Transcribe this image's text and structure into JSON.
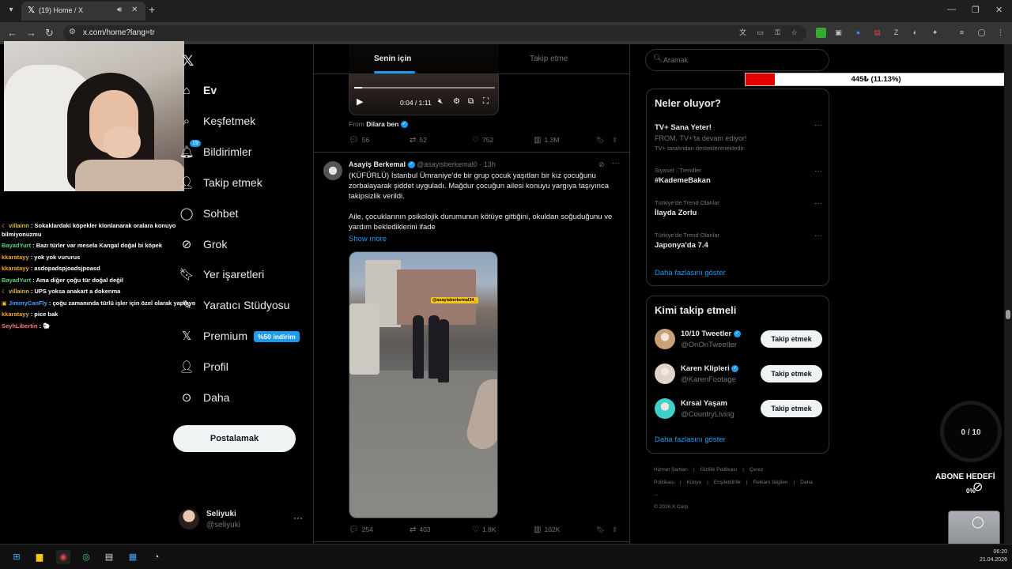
{
  "browser": {
    "tab_title": "(19) Home / X",
    "url": "x.com/home?lang=tr"
  },
  "chat": [
    {
      "user": "villainn",
      "color": "#d9b84a",
      "text": "Sokaklardaki köpekler klonlanarak oralara konuyo bilmiyonuzmu",
      "badge": "moon"
    },
    {
      "user": "BayadYurt",
      "color": "#5bd17a",
      "text": "Bazı türler var mesela Kangal doğal bi köpek",
      "badge": ""
    },
    {
      "user": "kkaratayy",
      "color": "#f0a830",
      "text": "yok yok vururus",
      "badge": ""
    },
    {
      "user": "kkaratayy",
      "color": "#f0a830",
      "text": "asdopadspjoadsjpoasd",
      "badge": ""
    },
    {
      "user": "BayadYurt",
      "color": "#5bd17a",
      "text": "Ama diğer çoğu tür doğal değil",
      "badge": ""
    },
    {
      "user": "villainn",
      "color": "#d9b84a",
      "text": "UPS yoksa anakart a dokenma",
      "badge": "moon"
    },
    {
      "user": "JimmyCanFly",
      "color": "#4a9cff",
      "text": "çoğu zamanında türlü işler için özel olarak yapılıyo",
      "badge": "sub"
    },
    {
      "user": "kkaratayy",
      "color": "#f0a830",
      "text": "pice bak",
      "badge": ""
    },
    {
      "user": "SeyhLibertin",
      "color": "#ff7a7a",
      "text": "🐑",
      "badge": ""
    }
  ],
  "nav": {
    "items": [
      {
        "label": "Ev",
        "icon": "home-icon"
      },
      {
        "label": "Keşfetmek",
        "icon": "search-icon"
      },
      {
        "label": "Bildirimler",
        "icon": "bell-icon"
      },
      {
        "label": "Takip etmek",
        "icon": "follow-icon"
      },
      {
        "label": "Sohbet",
        "icon": "chat-icon"
      },
      {
        "label": "Grok",
        "icon": "grok-icon"
      },
      {
        "label": "Yer işaretleri",
        "icon": "bookmark-icon"
      },
      {
        "label": "Yaratıcı Stüdyosu",
        "icon": "studio-icon"
      },
      {
        "label": "Premium",
        "icon": "x-icon"
      },
      {
        "label": "Profil",
        "icon": "person-icon"
      },
      {
        "label": "Daha",
        "icon": "more-icon"
      }
    ],
    "notif_count": "19",
    "premium_badge": "%50 indirim",
    "post_label": "Postalamak",
    "account_name": "Seliyuki",
    "account_handle": "@seliyuki"
  },
  "timeline": {
    "tab_for_you": "Senin için",
    "tab_following": "Takip etme",
    "tweet1": {
      "video_time": "0:04 / 1:11",
      "video_progress": 0.056,
      "from_prefix": "From",
      "from_name": "Dilara ben",
      "replies": "56",
      "reposts": "52",
      "likes": "752",
      "views": "1.3M"
    },
    "tweet2": {
      "name": "Asayiş Berkemal",
      "handle": "@asayisberkemal0",
      "time": "· 13h",
      "text1": "(KÜFÜRLÜ) İstanbul Ümraniye'de bir grup çocuk yaşıtları bir kız çocuğunu zorbalayarak şiddet uyguladı. Mağdur çocuğun ailesi konuyu yargıya taşıyınca takipsizlik verildi.",
      "text2": "Aile, çocuklarının psikolojik durumunun kötüye gittiğini, okuldan soğuduğunu ve yardım beklediklerini ifade",
      "show_more": "Show more",
      "video_tag": "@asayisberkemal34_",
      "replies": "254",
      "reposts": "403",
      "likes": "1.8K",
      "views": "102K"
    }
  },
  "right": {
    "search_placeholder": "Aramak",
    "donation_text": "445₺ (11.13%)",
    "donation_fraction": 0.1113,
    "trends_title": "Neler oluyor?",
    "trends": [
      {
        "meta": "",
        "name": "TV+ Sana Yeter!",
        "sub": "FROM, TV+'ta devam ediyor!",
        "sub2": "TV+ tarafından desteklenmektedir."
      },
      {
        "meta": "Siyaset · Trendler",
        "name": "#KademeBakan",
        "sub": "",
        "sub2": ""
      },
      {
        "meta": "Türkiye'de Trend Olanlar",
        "name": "İlayda Zorlu",
        "sub": "",
        "sub2": ""
      },
      {
        "meta": "Türkiye'de Trend Olanlar",
        "name": "Japonya'da 7.4",
        "sub": "",
        "sub2": ""
      }
    ],
    "show_more": "Daha fazlasını göster",
    "who_title": "Kimi takip etmeli",
    "who": [
      {
        "name": "10/10 Tweetler",
        "handle": "@OnOnTweetler",
        "verified": true,
        "follow": "Takip etmek",
        "avatar_color": "#c9a27a"
      },
      {
        "name": "Karen Klipleri",
        "handle": "@KarenFootage",
        "verified": true,
        "follow": "Takip etmek",
        "avatar_color": "#e0d4c8"
      },
      {
        "name": "Kırsal Yaşam",
        "handle": "@CountryLiving",
        "verified": false,
        "follow": "Takip etmek",
        "avatar_color": "#3fd0c9"
      }
    ],
    "footer": [
      "Hizmet Şartları",
      "|",
      "Gizlilik Politikası",
      "|",
      "Çerez Politikası",
      "|",
      "Künye",
      "|",
      "Erişilebilirlik",
      "|",
      "Reklam bilgileri",
      "|",
      "Daha ...",
      "© 2026 X Corp."
    ]
  },
  "stream": {
    "goal_text": "0 / 10",
    "sub_goal": "ABONE HEDEFİ",
    "sub_goal_pct": "0%"
  },
  "taskbar": {
    "time": "06:20",
    "date": "21.04.2026"
  }
}
